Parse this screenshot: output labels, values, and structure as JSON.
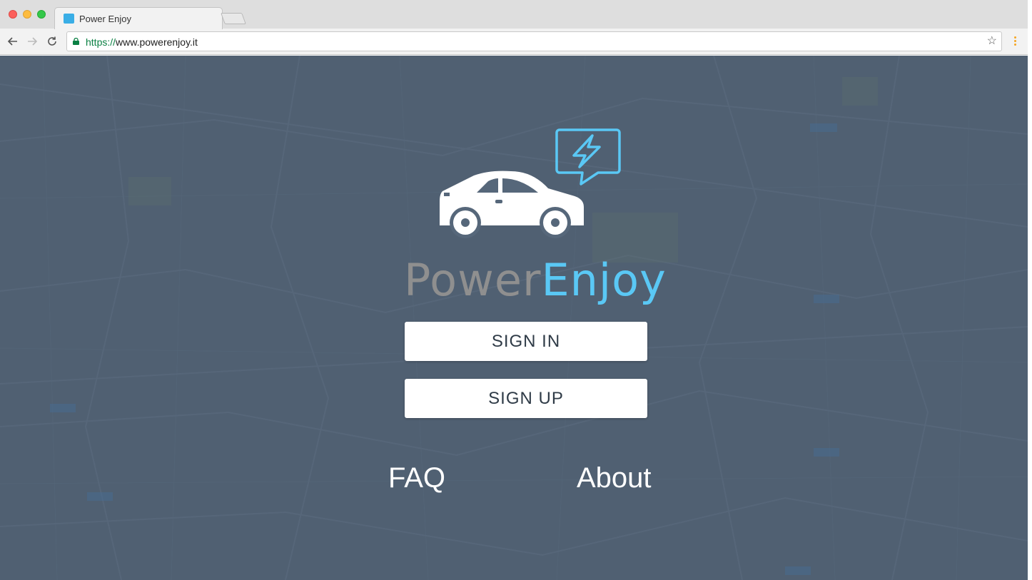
{
  "browser": {
    "tab_title": "Power Enjoy",
    "url_scheme": "https://",
    "url_rest": "www.powerenjoy.it",
    "favicon_color": "#3aaee6"
  },
  "page": {
    "brand_part1": "Power",
    "brand_part2": "Enjoy",
    "brand_color_primary": "#8f8f8f",
    "brand_color_accent": "#5ac8f5",
    "logo_icons": [
      "car-icon",
      "lightning-bolt-icon",
      "speech-bubble-icon"
    ],
    "buttons": {
      "sign_in": "SIGN IN",
      "sign_up": "SIGN UP"
    },
    "links": {
      "faq": "FAQ",
      "about": "About"
    },
    "background": "map-background"
  }
}
